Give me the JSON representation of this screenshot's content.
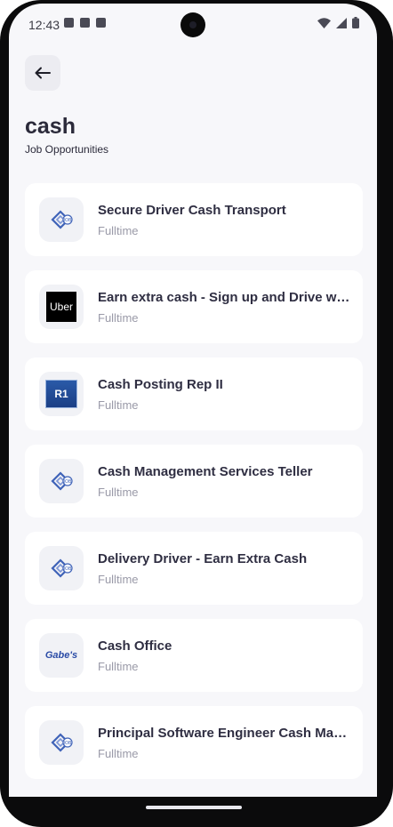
{
  "status_bar": {
    "time": "12:43"
  },
  "header": {
    "title": "cash",
    "subtitle": "Job Opportunities"
  },
  "jobs": [
    {
      "title": "Secure Driver Cash Transport",
      "type": "Fulltime",
      "logo": "job-icon"
    },
    {
      "title": "Earn extra cash - Sign up and Drive with Uber",
      "type": "Fulltime",
      "logo": "uber-logo",
      "logo_text": "Uber"
    },
    {
      "title": "Cash Posting Rep II",
      "type": "Fulltime",
      "logo": "r1-logo",
      "logo_text": "R1"
    },
    {
      "title": "Cash Management Services Teller",
      "type": "Fulltime",
      "logo": "job-icon"
    },
    {
      "title": "Delivery Driver - Earn Extra Cash",
      "type": "Fulltime",
      "logo": "job-icon"
    },
    {
      "title": "Cash Office",
      "type": "Fulltime",
      "logo": "gabes-logo",
      "logo_text": "Gabe's"
    },
    {
      "title": "Principal Software Engineer Cash Management",
      "type": "Fulltime",
      "logo": "job-icon"
    }
  ],
  "colors": {
    "background": "#f7f7fa",
    "card": "#ffffff",
    "title": "#2f2e42",
    "muted": "#9a9aa8"
  }
}
